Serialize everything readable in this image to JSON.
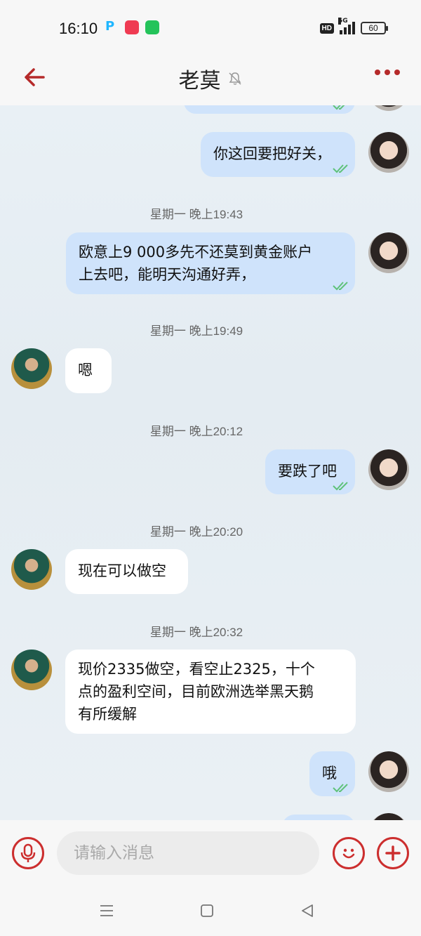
{
  "status_bar": {
    "time": "16:10",
    "hd": "HD",
    "network": "5G",
    "battery": "60"
  },
  "header": {
    "title": "老莫",
    "back_icon": "back-arrow-icon",
    "mute_icon": "bell-muted-icon",
    "more_icon": "more-dots-icon",
    "accent_color": "#b52a2a"
  },
  "messages": [
    {
      "type": "out",
      "text": "你这回要把好关，",
      "read": true
    },
    {
      "type": "time",
      "text": "星期一 晚上19:43"
    },
    {
      "type": "out",
      "lines": [
        "欧意上9 000多先不还莫到黄金账户",
        "上去吧，能明天沟通好弄，"
      ],
      "read": true
    },
    {
      "type": "time",
      "text": "星期一 晚上19:49"
    },
    {
      "type": "in",
      "text": "嗯"
    },
    {
      "type": "time",
      "text": "星期一 晚上20:12"
    },
    {
      "type": "out",
      "text": "要跌了吧",
      "read": true
    },
    {
      "type": "time",
      "text": "星期一 晚上20:20"
    },
    {
      "type": "in",
      "text": "现在可以做空"
    },
    {
      "type": "time",
      "text": "星期一 晚上20:32"
    },
    {
      "type": "in",
      "lines": [
        "现价2335做空，看空止2325，十个",
        "点的盈利空间，目前欧洲选举黑天鹅",
        "有所缓解"
      ]
    },
    {
      "type": "out",
      "text": "哦",
      "read": true
    }
  ],
  "input": {
    "placeholder": "请输入消息",
    "mic_icon": "microphone-icon",
    "emoji_icon": "emoji-icon",
    "add_icon": "plus-icon"
  },
  "nav": {
    "menu_icon": "menu-icon",
    "home_icon": "home-icon",
    "back_icon": "back-triangle-icon"
  }
}
